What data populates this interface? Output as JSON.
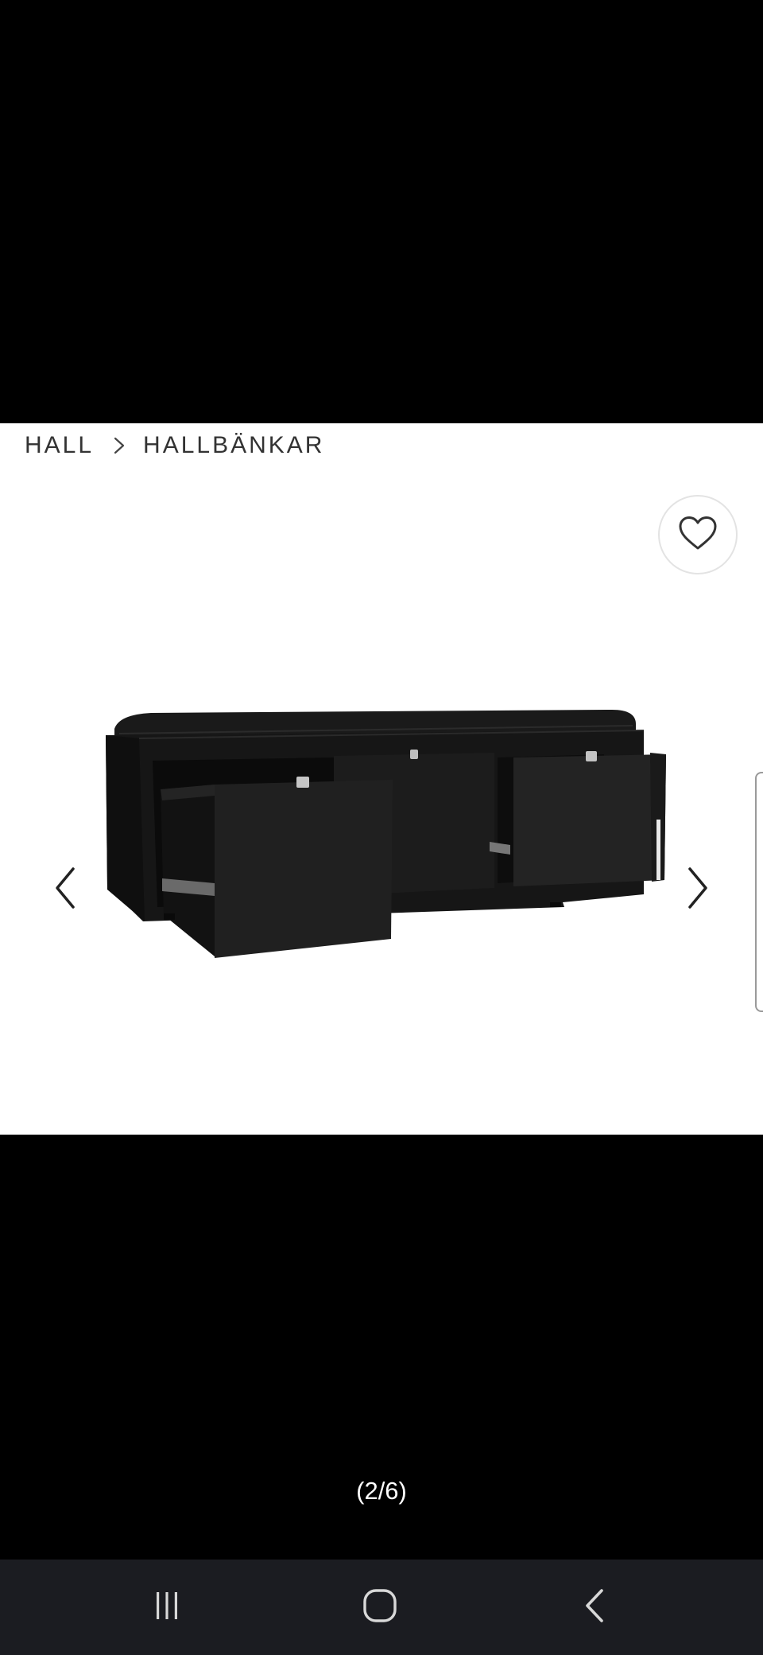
{
  "breadcrumb": {
    "items": [
      "HALL",
      "HALLBÄNKAR"
    ]
  },
  "gallery": {
    "counter": "(2/6)",
    "current_index": 2,
    "total": 6,
    "favorite_icon": "heart-outline-icon",
    "prev_icon": "chevron-left-icon",
    "next_icon": "chevron-right-icon"
  },
  "system_nav": {
    "recents_icon": "recents-icon",
    "home_icon": "home-icon",
    "back_icon": "back-icon"
  },
  "colors": {
    "backdrop": "#000000",
    "slide_background": "#ffffff",
    "navbar": "#1b1c21"
  }
}
